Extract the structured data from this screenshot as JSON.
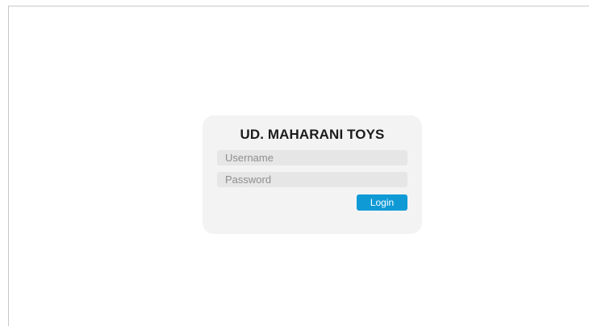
{
  "login": {
    "title": "UD. MAHARANI TOYS",
    "username": {
      "placeholder": "Username",
      "value": ""
    },
    "password": {
      "placeholder": "Password",
      "value": ""
    },
    "submit_label": "Login"
  },
  "colors": {
    "page_background": "#ffffff",
    "card_background": "#f3f3f4",
    "input_background": "#e6e6e6",
    "button_accent": "#0f9ad6",
    "title_text": "#1c1c1c"
  }
}
